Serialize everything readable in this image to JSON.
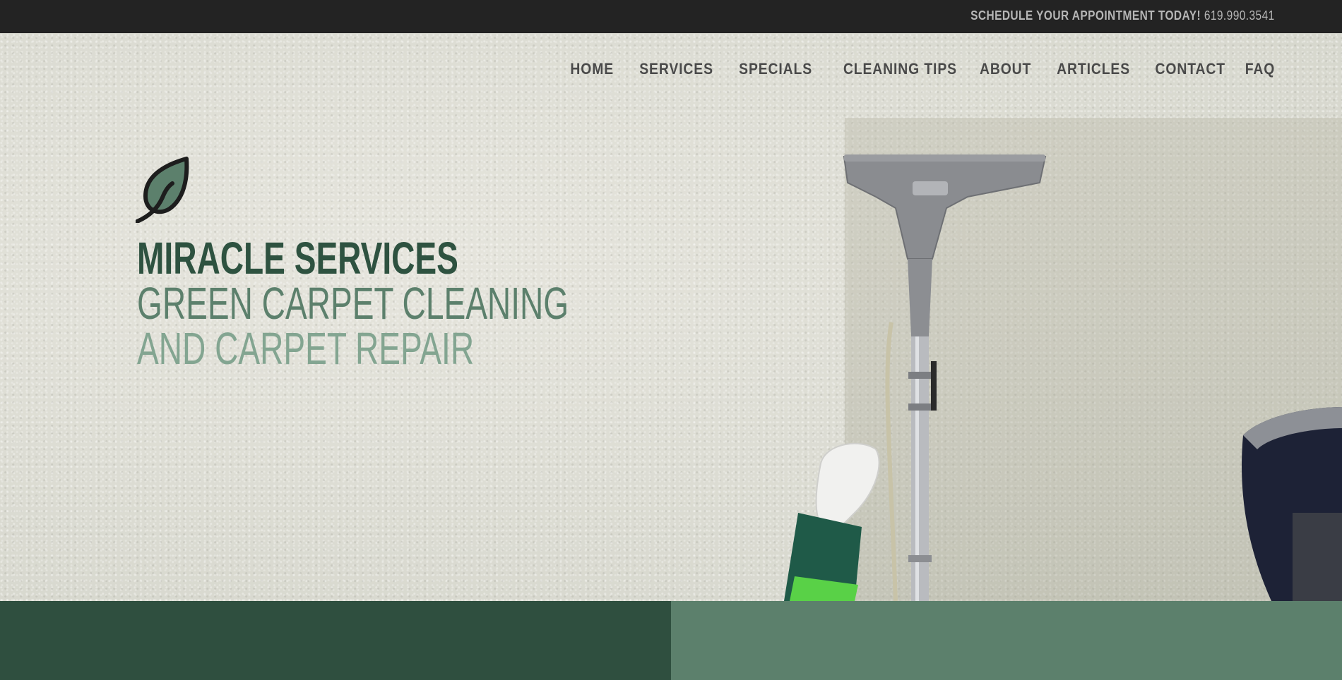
{
  "topbar": {
    "cta": "SCHEDULE YOUR APPOINTMENT TODAY!",
    "phone": "619.990.3541"
  },
  "nav": {
    "items": [
      {
        "label": "HOME"
      },
      {
        "label": "SERVICES"
      },
      {
        "label": "SPECIALS"
      },
      {
        "label": "CLEANING TIPS"
      },
      {
        "label": "ABOUT"
      },
      {
        "label": "ARTICLES"
      },
      {
        "label": "CONTACT"
      },
      {
        "label": "FAQ"
      }
    ]
  },
  "brand": {
    "logo_icon": "leaf-icon",
    "line1": "MIRACLE SERVICES",
    "line2": "GREEN CARPET CLEANING",
    "line3": "AND CARPET REPAIR"
  },
  "colors": {
    "topbar_bg": "#232323",
    "dark_green": "#2f4f3f",
    "mid_green": "#5c806c",
    "light_green": "#83a591"
  }
}
